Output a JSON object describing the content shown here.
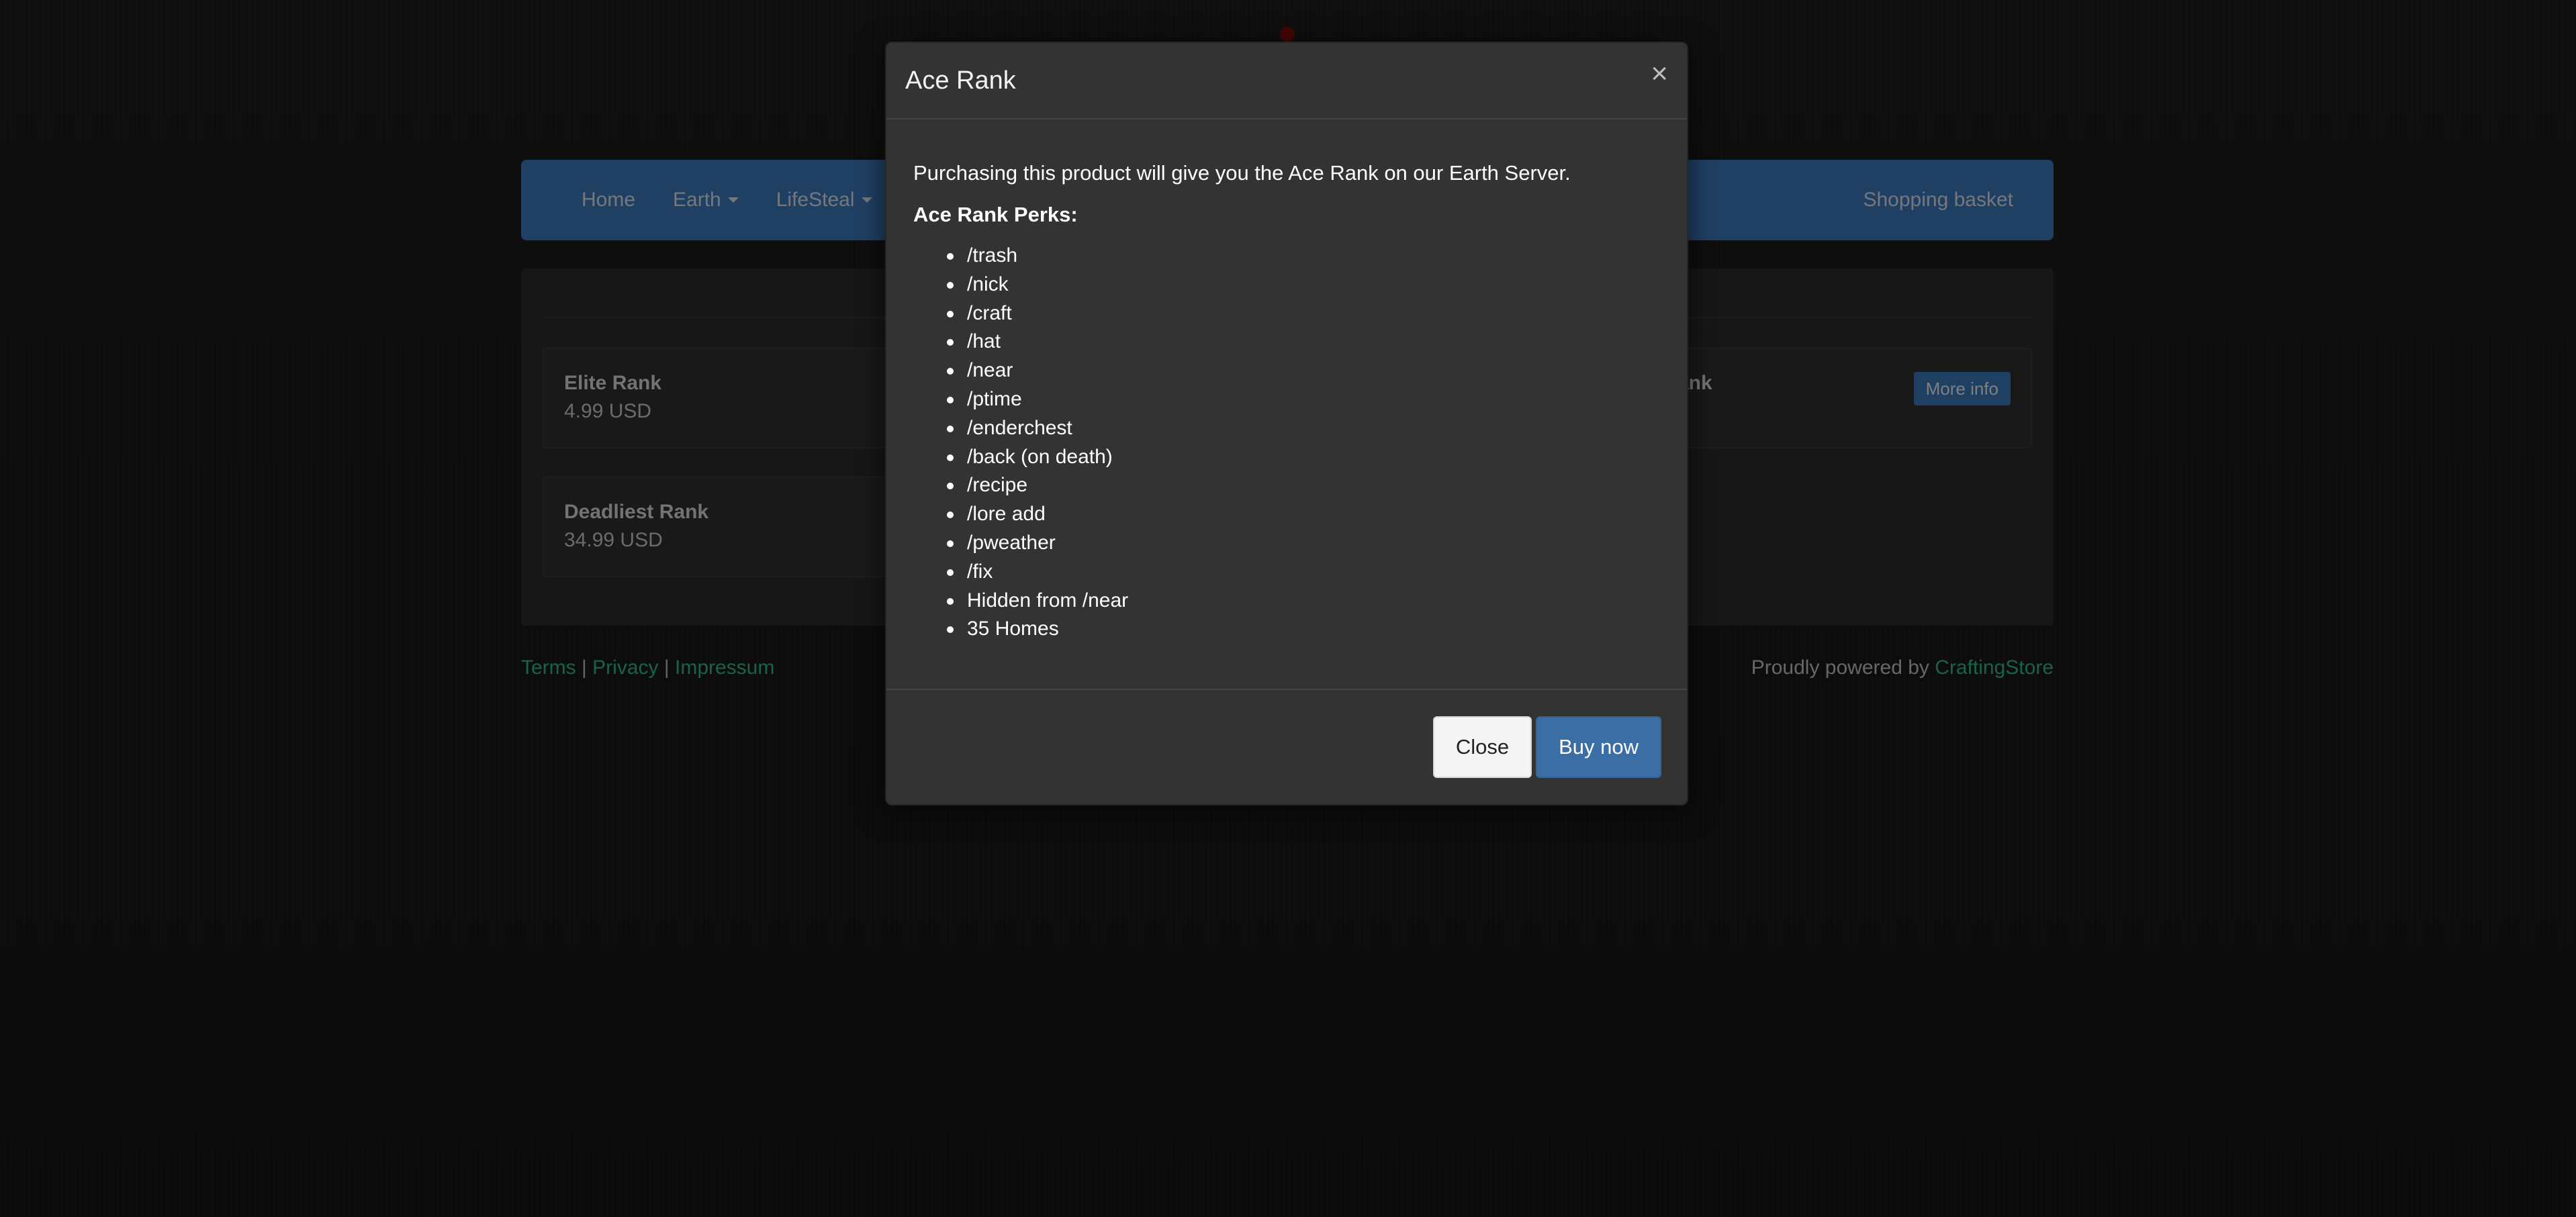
{
  "nav": {
    "items": [
      {
        "label": "Home",
        "dropdown": false
      },
      {
        "label": "Earth",
        "dropdown": true
      },
      {
        "label": "LifeSteal",
        "dropdown": true
      }
    ],
    "basket_label": "Shopping basket"
  },
  "products": [
    {
      "name": "Elite Rank",
      "price": "4.99 USD"
    },
    {
      "name": "Deadliest Rank",
      "price": "34.99 USD"
    },
    {
      "name_fragment": "ank",
      "button": "More info"
    }
  ],
  "footer": {
    "terms": "Terms",
    "privacy": "Privacy",
    "impressum": "Impressum",
    "separator": "|",
    "powered_prefix": "Proudly powered by ",
    "powered_link": "CraftingStore"
  },
  "modal": {
    "title": "Ace Rank",
    "close_icon": "×",
    "intro": "Purchasing this product will give you the Ace Rank on our Earth Server.",
    "perks_title": "Ace Rank Perks:",
    "perks": [
      "/trash",
      "/nick",
      "/craft",
      "/hat",
      "/near",
      "/ptime",
      "/enderchest",
      "/back (on death)",
      "/recipe",
      "/lore add",
      "/pweather",
      "/fix",
      "Hidden from /near",
      "35 Homes"
    ],
    "close_button": "Close",
    "buy_button": "Buy now"
  },
  "colors": {
    "navbar": "#3f7fc7",
    "link_green": "#33c48f",
    "buy_button": "#3a6ea5"
  }
}
